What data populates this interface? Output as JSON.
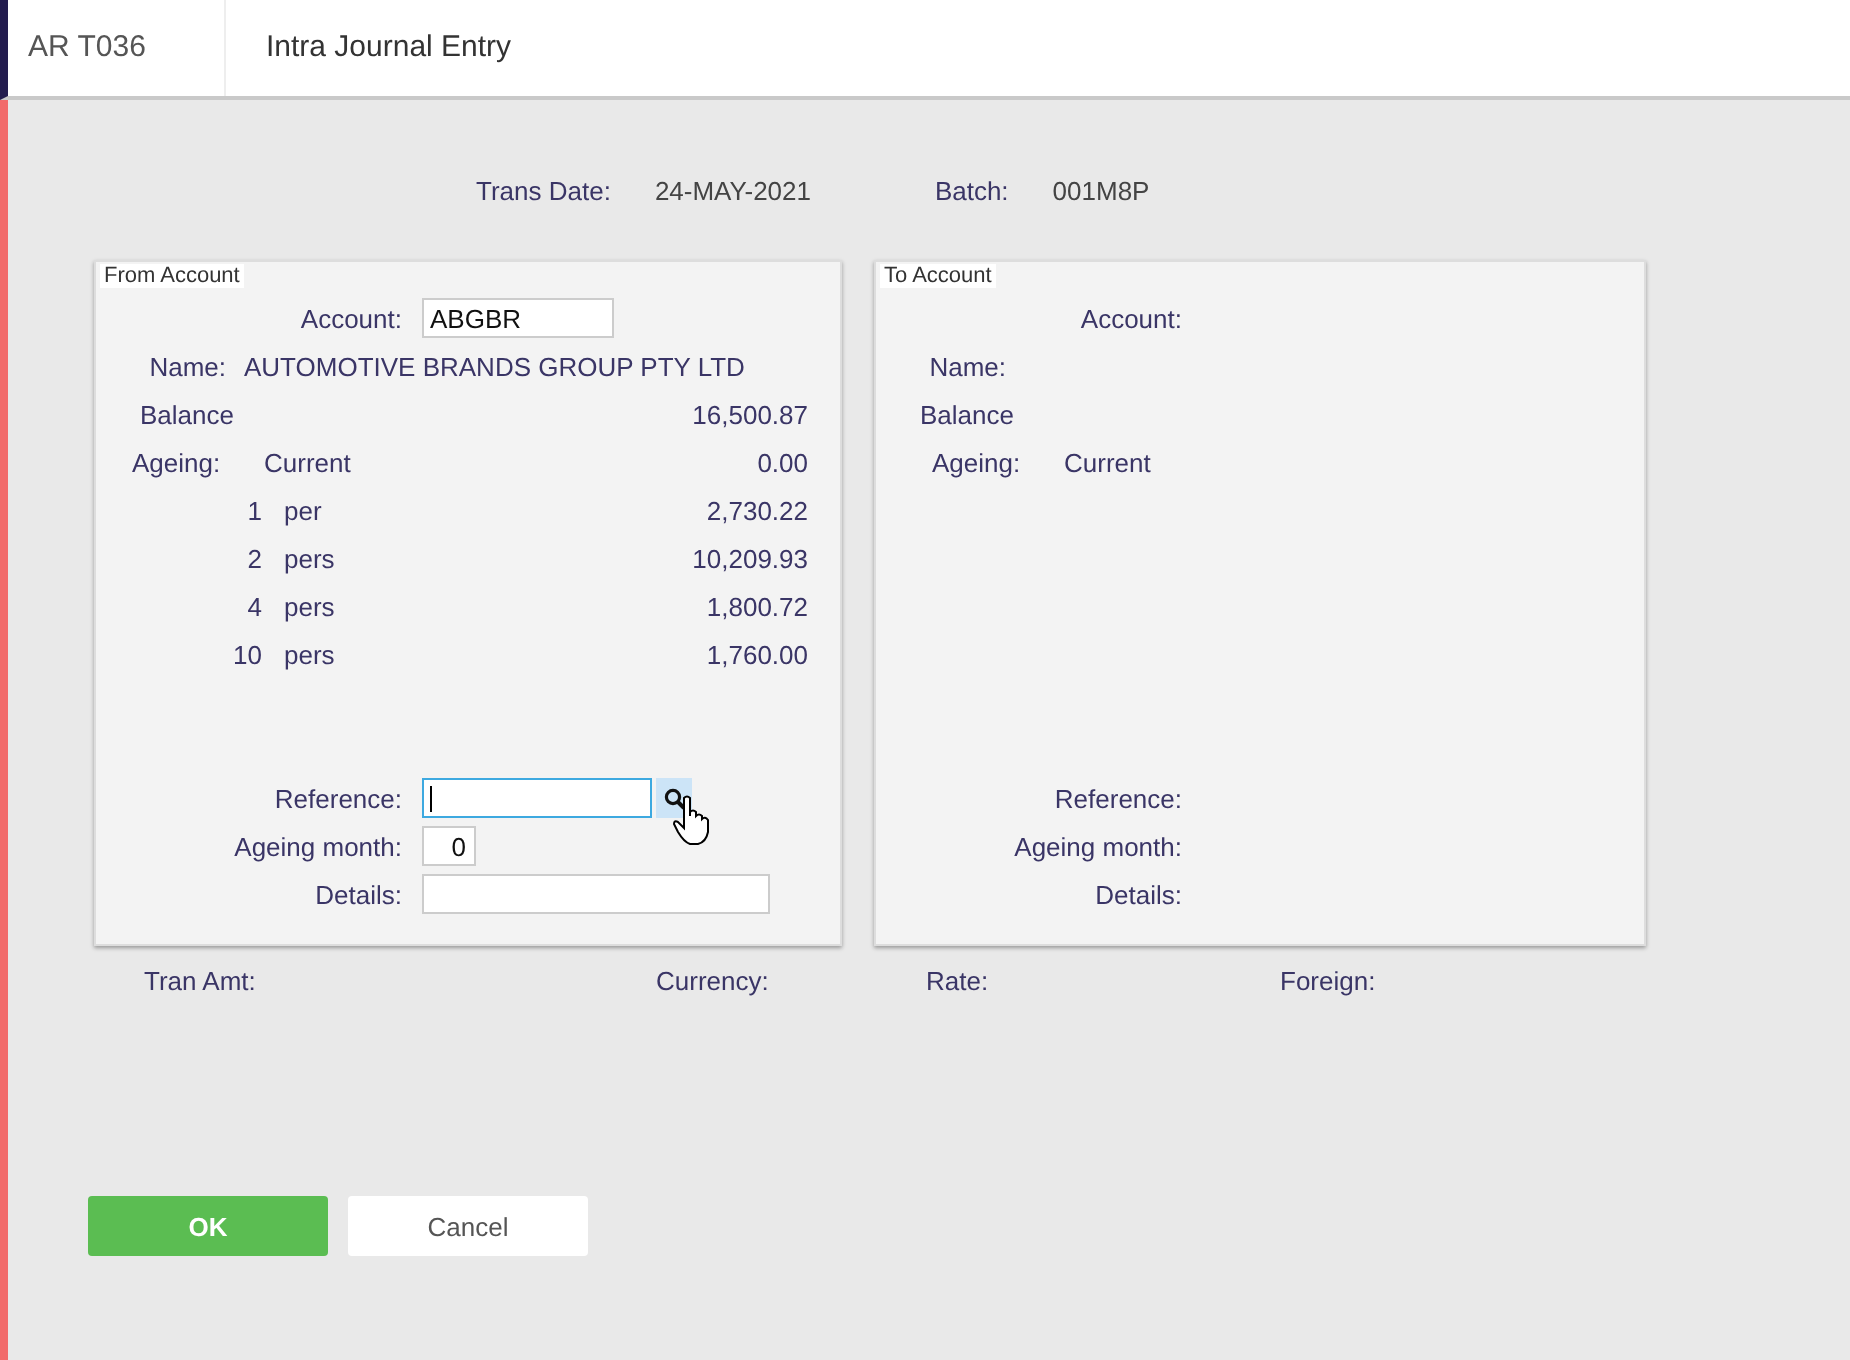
{
  "header": {
    "code": "AR T036",
    "title": "Intra Journal Entry"
  },
  "trans": {
    "date_label": "Trans Date:",
    "date": "24-MAY-2021",
    "batch_label": "Batch:",
    "batch": "001M8P"
  },
  "from_account": {
    "legend": "From Account",
    "account_label": "Account:",
    "account": "ABGBR",
    "name_label": "Name:",
    "name": "AUTOMOTIVE BRANDS GROUP PTY LTD",
    "balance_label": "Balance",
    "balance": "16,500.87",
    "ageing_label": "Ageing:",
    "current_label": "Current",
    "current": "0.00",
    "periods": [
      {
        "count": "1",
        "unit": "per",
        "amount": "2,730.22"
      },
      {
        "count": "2",
        "unit": "pers",
        "amount": "10,209.93"
      },
      {
        "count": "4",
        "unit": "pers",
        "amount": "1,800.72"
      },
      {
        "count": "10",
        "unit": "pers",
        "amount": "1,760.00"
      }
    ],
    "reference_label": "Reference:",
    "reference_focused": true,
    "ageing_month_label": "Ageing month:",
    "ageing_month": "0",
    "details_label": "Details:"
  },
  "to_account": {
    "legend": "To Account",
    "account_label": "Account:",
    "name_label": "Name:",
    "balance_label": "Balance",
    "ageing_label": "Ageing:",
    "current_label": "Current",
    "reference_label": "Reference:",
    "ageing_month_label": "Ageing month:",
    "details_label": "Details:"
  },
  "totals": {
    "tran_amt_label": "Tran Amt:",
    "currency_label": "Currency:",
    "rate_label": "Rate:",
    "foreign_label": "Foreign:"
  },
  "buttons": [
    {
      "label": "OK",
      "kind": "primary"
    },
    {
      "label": "Cancel",
      "kind": "secondary"
    }
  ]
}
